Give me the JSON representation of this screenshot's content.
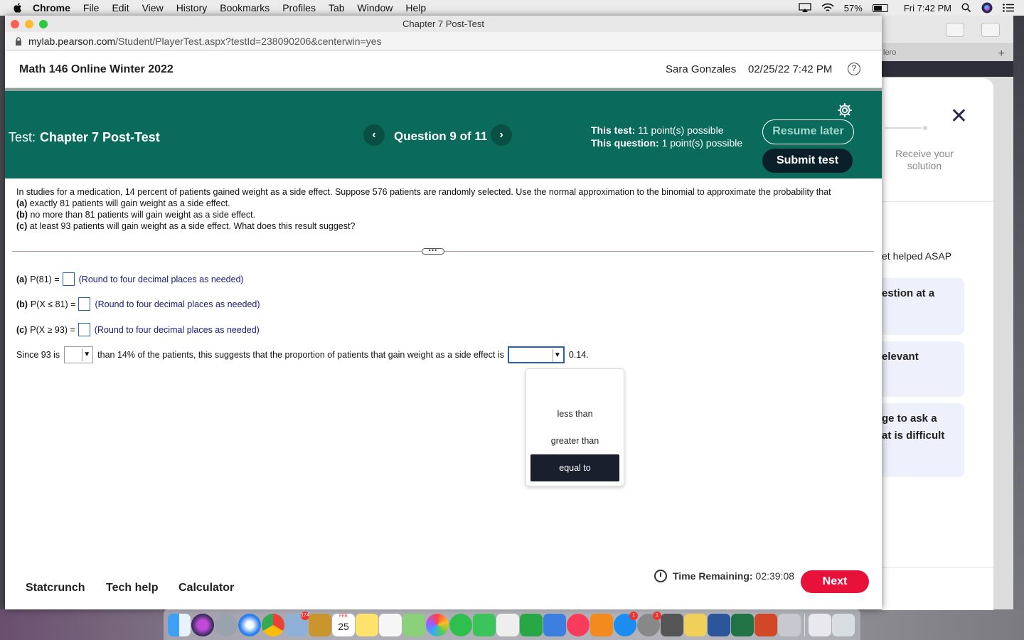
{
  "menubar": {
    "app": "Chrome",
    "items": [
      "File",
      "Edit",
      "View",
      "History",
      "Bookmarks",
      "Profiles",
      "Tab",
      "Window",
      "Help"
    ],
    "battery": "57%",
    "clock": "Fri 7:42 PM"
  },
  "window": {
    "title": "Chapter 7 Post-Test",
    "url_host": "mylab.pearson.com",
    "url_path": "/Student/PlayerTest.aspx?testId=238090206&centerwin=yes"
  },
  "course": {
    "name": "Math 146 Online Winter 2022",
    "user": "Sara Gonzales",
    "datetime": "02/25/22 7:42 PM",
    "help": "?"
  },
  "test": {
    "label": "Test:",
    "name": "Chapter 7 Post-Test",
    "prev": "‹",
    "next": "›",
    "question": "Question 9 of 11",
    "this_test_label": "This test:",
    "this_test_value": "11 point(s) possible",
    "this_question_label": "This question:",
    "this_question_value": "1 point(s) possible",
    "resume": "Resume later",
    "submit": "Submit test"
  },
  "problem": {
    "intro": "In studies for a medication, 14 percent of patients gained weight as a side effect. Suppose 576 patients are randomly selected. Use the normal approximation to the binomial to approximate the probability that",
    "a_label": "(a)",
    "a_text": "exactly 81 patients will gain weight as a side effect.",
    "b_label": "(b)",
    "b_text": "no more than 81 patients will gain weight as a side effect.",
    "c_label": "(c)",
    "c_text": "at least 93 patients will gain weight as a side effect. What does this result suggest?"
  },
  "answers": {
    "a_label": "(a)",
    "a_expr": "P(81) =",
    "a_hint": "(Round to four decimal places as needed)",
    "a_value": "",
    "b_label": "(b)",
    "b_expr": "P(X ≤ 81) =",
    "b_hint": "(Round to four decimal places as needed)",
    "b_value": "",
    "c_label": "(c)",
    "c_expr": "P(X ≥ 93) =",
    "c_hint": "(Round to four decimal places as needed)",
    "c_value": ""
  },
  "conclusion": {
    "part1": "Since 93 is",
    "select1_value": "",
    "part2": "than 14% of the patients, this suggests that the proportion of patients that gain weight as a side effect is",
    "select2_value": "",
    "part3": "0.14."
  },
  "dropdown": {
    "options": [
      "less than",
      "greater than",
      "equal to"
    ],
    "highlighted": "equal to"
  },
  "footer": {
    "tools": [
      "Statcrunch",
      "Tech help",
      "Calculator"
    ],
    "time_label": "Time Remaining:",
    "time_value": "02:39:08",
    "next": "Next"
  },
  "side_panel": {
    "tab_label": "lero",
    "receive": "Receive your solution",
    "helped": "et helped ASAP",
    "card1": "estion at a",
    "card2": "elevant",
    "card3a": "ge to ask a",
    "card3b": "at is difficult"
  },
  "colors": {
    "test_bar": "#0a6b5c",
    "submit_bg": "#0b1f2a",
    "next_bg": "#e8113a",
    "hint_text": "#1a1a7a"
  },
  "dock": {
    "icons": [
      "finder-icon",
      "siri-icon",
      "launchpad-icon",
      "safari-icon",
      "chrome-icon",
      "preview-icon",
      "notes-book-icon",
      "calendar-icon",
      "stickies-icon",
      "reminders-icon",
      "maps-icon",
      "photos-icon",
      "messages-icon",
      "facetime-icon",
      "textedit-icon",
      "numbers-icon",
      "keynote-icon",
      "music-icon",
      "books-icon",
      "app-store-icon",
      "system-preferences-icon",
      "calculator-icon",
      "folder-icon",
      "word-icon",
      "excel-icon",
      "powerpoint-icon",
      "scanner-icon",
      "downloads-icon",
      "trash-icon"
    ],
    "badge_preview": "174",
    "calendar_day": "25",
    "calendar_month": "FEB",
    "badge_appstore": "1",
    "badge_sysprefs": "1"
  }
}
